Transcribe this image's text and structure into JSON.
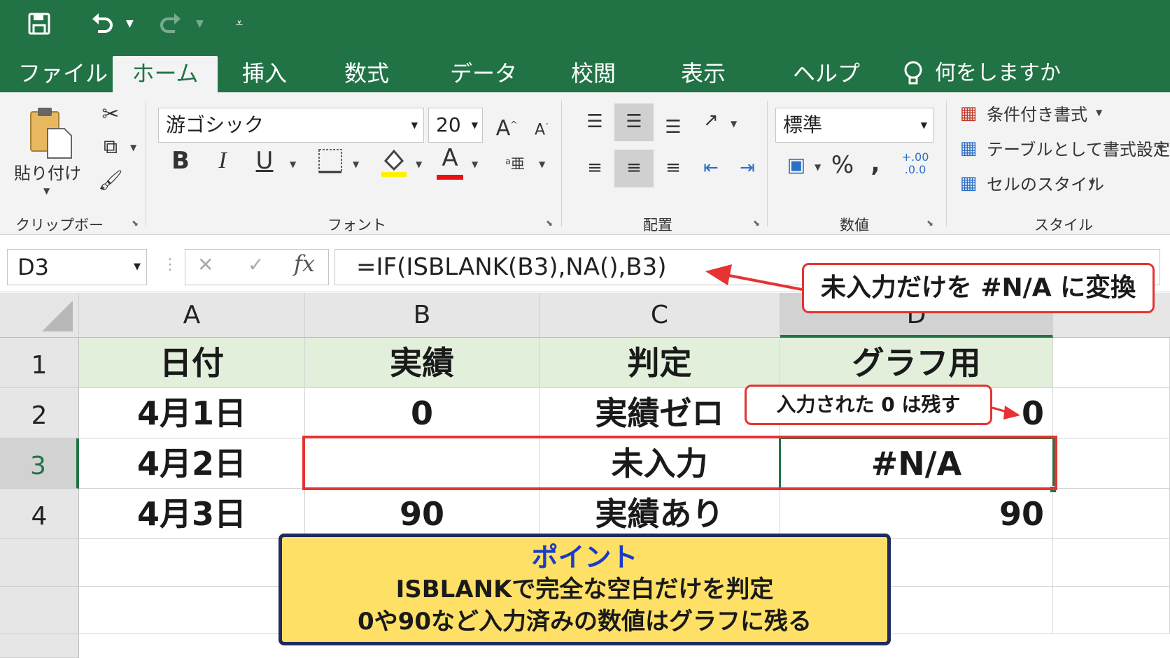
{
  "quick_access": {
    "save_icon": "save-icon",
    "undo_icon": "undo-icon",
    "redo_icon": "redo-icon",
    "customize_icon": "customize-icon"
  },
  "tabs": [
    {
      "label": "ファイル"
    },
    {
      "label": "ホーム"
    },
    {
      "label": "挿入"
    },
    {
      "label": "数式"
    },
    {
      "label": "データ"
    },
    {
      "label": "校閲"
    },
    {
      "label": "表示"
    },
    {
      "label": "ヘルプ"
    }
  ],
  "tell_me": "何をしますか",
  "ribbon": {
    "clipboard": {
      "label": "クリップボード",
      "paste_label": "貼り付け"
    },
    "font": {
      "label": "フォント",
      "font_name": "游ゴシック",
      "font_size": "20",
      "bold": "B",
      "italic": "I",
      "underline": "U",
      "font_color_glyph": "A"
    },
    "alignment": {
      "label": "配置"
    },
    "number": {
      "label": "数値",
      "format": "標準",
      "percent": "%",
      "comma": ","
    },
    "styles": {
      "label": "スタイル",
      "conditional": "条件付き書式",
      "table": "テーブルとして書式設定",
      "cell_styles": "セルのスタイル"
    }
  },
  "formula_bar": {
    "name_box": "D3",
    "cancel": "✕",
    "enter": "✓",
    "fx": "fx",
    "formula": "=IF(ISBLANK(B3),NA(),B3)"
  },
  "sheet": {
    "columns": [
      "A",
      "B",
      "C",
      "D"
    ],
    "rows": [
      "1",
      "2",
      "3",
      "4",
      "",
      "",
      ""
    ],
    "header": [
      "日付",
      "実績",
      "判定",
      "グラフ用"
    ],
    "data": [
      [
        "4月1日",
        "0",
        "実績ゼロ",
        "0"
      ],
      [
        "4月2日",
        "",
        "未入力",
        "#N/A"
      ],
      [
        "4月3日",
        "90",
        "実績あり",
        "90"
      ]
    ]
  },
  "callouts": {
    "formula_note": "未入力だけを #N/A に変換",
    "zero_note": "入力された 0 は残す"
  },
  "point": {
    "title": "ポイント",
    "line1": "ISBLANKで完全な空白だけを判定",
    "line2": "0や90など入力済みの数値はグラフに残る"
  },
  "colors": {
    "excel_green": "#217346",
    "header_fill": "#e2efda",
    "callout_red": "#e53333",
    "point_fill": "#ffe066",
    "point_border": "#1f2b5e",
    "point_title": "#1a3cc8"
  }
}
